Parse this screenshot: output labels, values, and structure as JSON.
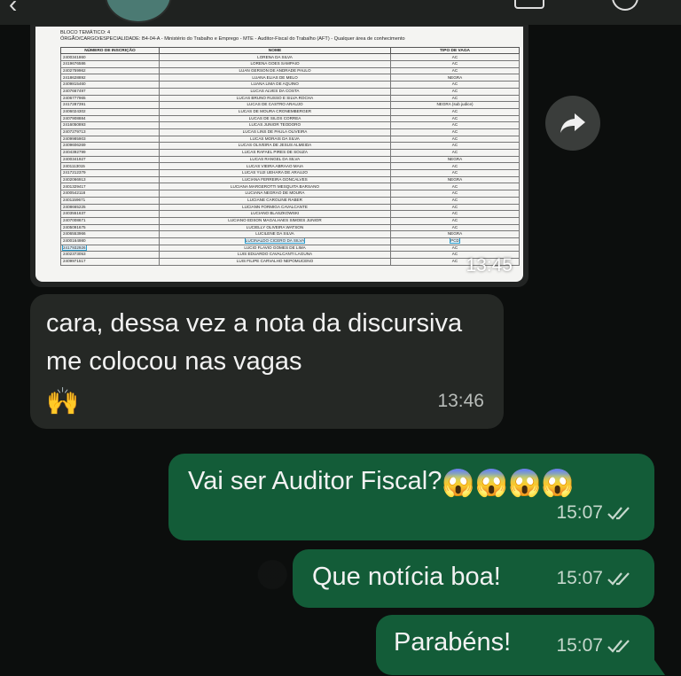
{
  "document": {
    "bloco": "BLOCO TEMÁTICO: 4",
    "orgao": "ÓRGÃO/CARGO/ESPECIALIDADE: B4-04-A - Ministério do Trabalho e Emprego - MTE - Auditor-Fiscal do Trabalho (AFT) - Qualquer área de conhecimento",
    "columns": [
      "NÚMERO DE INSCRIÇÃO",
      "NOME",
      "TIPO DE VAGA"
    ],
    "rows": [
      [
        "2400341860",
        "LORENA DA SILVA",
        "AC"
      ],
      [
        "2419676586",
        "LORENA GOES SAMPAIO",
        "AC"
      ],
      [
        "2402759962",
        "LUAN GERSON DE ANDRADE PAULO",
        "AC"
      ],
      [
        "2418628892",
        "LUANA ELIAS DE MELO",
        "NEGRA"
      ],
      [
        "2409815460",
        "LUANA LIMA DE AQUINO",
        "AC"
      ],
      [
        "2407667497",
        "LUCAS ALVES DA COSTA",
        "AC"
      ],
      [
        "2406777965",
        "LUCAS BRUNO RUSSO E SILVA ROCHA",
        "AC"
      ],
      [
        "2417287391",
        "LUCAS DE CASTRO ARAUJO",
        "NEGRA (sub judice)"
      ],
      [
        "2406024302",
        "LUCAS DE MOURA CRONEMBERGER",
        "AC"
      ],
      [
        "2407908884",
        "LUCAS DE SILOS CORREA",
        "AC"
      ],
      [
        "2416050893",
        "LUCAS JUNIOR TEODORO",
        "AC"
      ],
      [
        "2407279713",
        "LUCAS LINS DE PAULA OLIVEIRA",
        "AC"
      ],
      [
        "2409985903",
        "LUCAS MORAIS DA SILVA",
        "AC"
      ],
      [
        "2409606269",
        "LUCAS OLIVEIRA DE JESUS ALMEIDA",
        "AC"
      ],
      [
        "2404392799",
        "LUCAS RAFAEL PIRES DE SOUZA",
        "AC"
      ],
      [
        "2400341927",
        "LUCAS RANGEL DA SILVA",
        "NEGRA"
      ],
      [
        "2401113015",
        "LUCAS VIEIRA ABRAAO MAIA",
        "AC"
      ],
      [
        "2417212379",
        "LUCAS YUJI UEHARA DE ARAUJO",
        "AC"
      ],
      [
        "2402066913",
        "LUCIANA FERREIRA GONCALVES",
        "NEGRA"
      ],
      [
        "2401329417",
        "LUCIANA MARGEROTTI MESQUITA BARSANO",
        "AC"
      ],
      [
        "2400542118",
        "LUCIANA NEGRAO DE MOURA",
        "AC"
      ],
      [
        "2401159671",
        "LUCIANE CAROLINE RABER",
        "AC"
      ],
      [
        "2408665225",
        "LUCIANN FORMIGA CAVALCANTE",
        "AC"
      ],
      [
        "2403551637",
        "LUCIANO BLASZKOWSKI",
        "AC"
      ],
      [
        "2407008671",
        "LUCIANO EDSON MAGALHAES SIMOES JUNIOR",
        "AC"
      ],
      [
        "2405091675",
        "LUCIELLY OLIVEIRA WATSON",
        "AC"
      ],
      [
        "2406553966",
        "LUCILENE DA SILVA",
        "NEGRA"
      ],
      [
        "2400164980",
        "LUCINALDO CICERO DA SILVA",
        "PCD"
      ],
      [
        "2417932926",
        "LUCIO FLAVIO GOMES DE LIMA",
        "AC"
      ],
      [
        "2402373053",
        "LUIS EDUARDO CAVALCANTI LAGUNA",
        "AC"
      ],
      [
        "2409971517",
        "LUIS FILIPE CARVALHO NEPOMUCENO",
        "AC"
      ]
    ],
    "time": "13:45"
  },
  "messages": {
    "incoming": {
      "text": "cara, dessa vez a nota da discursiva  me colocou nas vagas",
      "emoji": "🙌",
      "time": "13:46"
    },
    "out1": {
      "text": "Vai ser Auditor Fiscal?",
      "emoji": "😱😱😱😱",
      "time": "15:07"
    },
    "out2": {
      "text": "Que notícia boa!",
      "time": "15:07"
    },
    "out3": {
      "text": "Parabéns!",
      "time": "15:07"
    }
  },
  "icons": {
    "forward": "forward-arrow-icon",
    "read": "double-check-icon"
  },
  "colors": {
    "incoming_bubble": "#252825",
    "outgoing_bubble": "#135c38",
    "read_ticks": "#c6d8cd"
  }
}
